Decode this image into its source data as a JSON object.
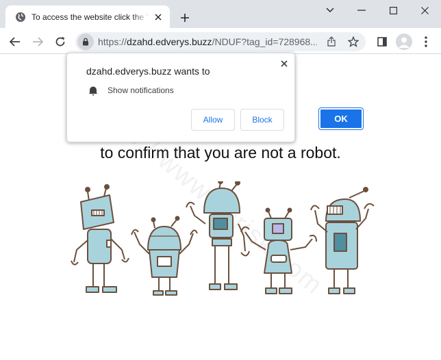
{
  "tab": {
    "title": "To access the website click the \"Allow\" button",
    "favicon": "globe-icon",
    "close_icon": "close-icon"
  },
  "window_controls": [
    "chevron-down-icon",
    "minimize-icon",
    "maximize-icon",
    "close-icon"
  ],
  "address_bar": {
    "scheme": "https://",
    "host": "dzahd.edverys.buzz",
    "path": "/NDUF?tag_id=728968...",
    "lock_icon": "lock-icon",
    "share_icon": "share-icon",
    "bookmark_icon": "star-icon"
  },
  "toolbar_icons": [
    "back-arrow-icon",
    "forward-arrow-icon",
    "reload-icon",
    "side-panel-icon",
    "profile-icon",
    "more-menu-icon"
  ],
  "page": {
    "headline": "to confirm that you are not a robot.",
    "ok_label": "OK",
    "watermark": "https://www.pcrisk.com"
  },
  "prompt": {
    "title": "dzahd.edverys.buzz wants to",
    "permission": "Show notifications",
    "allow_label": "Allow",
    "block_label": "Block"
  },
  "colors": {
    "accent": "#1a73e8",
    "chrome_frame": "#dfe3e8",
    "robot_body": "#a9d3dc",
    "robot_outline": "#6b4f3d"
  }
}
